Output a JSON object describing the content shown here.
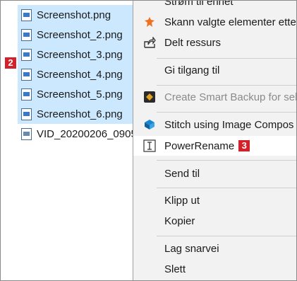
{
  "files": [
    {
      "name": "Screenshot.png",
      "selected": true,
      "icon": "image-file-icon"
    },
    {
      "name": "Screenshot_2.png",
      "selected": true,
      "icon": "image-file-icon"
    },
    {
      "name": "Screenshot_3.png",
      "selected": true,
      "icon": "image-file-icon"
    },
    {
      "name": "Screenshot_4.png",
      "selected": true,
      "icon": "image-file-icon"
    },
    {
      "name": "Screenshot_5.png",
      "selected": true,
      "icon": "image-file-icon"
    },
    {
      "name": "Screenshot_6.png",
      "selected": true,
      "icon": "image-file-icon"
    },
    {
      "name": "VID_20200206_0905",
      "selected": false,
      "icon": "video-file-icon"
    }
  ],
  "badges": {
    "files": "2",
    "powerrename": "3"
  },
  "menu": {
    "items": [
      {
        "label": "Strøm til enhet",
        "icon": null
      },
      {
        "label": "Skann valgte elementer ette",
        "icon": "bug-scan-icon"
      },
      {
        "label": "Delt ressurs",
        "icon": "share-icon"
      },
      {
        "label": "Gi tilgang til",
        "icon": null
      },
      {
        "label": "Create Smart Backup for sel",
        "icon": "smart-backup-icon",
        "disabled": true
      },
      {
        "label": "Stitch using Image Compos",
        "icon": "image-composite-icon"
      },
      {
        "label": "PowerRename",
        "icon": "powerrename-icon",
        "hover": true
      },
      {
        "label": "Send til",
        "icon": null
      },
      {
        "label": "Klipp ut",
        "icon": null
      },
      {
        "label": "Kopier",
        "icon": null
      },
      {
        "label": "Lag snarvei",
        "icon": null
      },
      {
        "label": "Slett",
        "icon": null
      }
    ]
  },
  "colors": {
    "selection": "#cce8ff",
    "menu_bg": "#f2f2f2",
    "badge": "#d3202a",
    "avast_orange": "#f07022",
    "composite_blue": "#1a86d0"
  }
}
